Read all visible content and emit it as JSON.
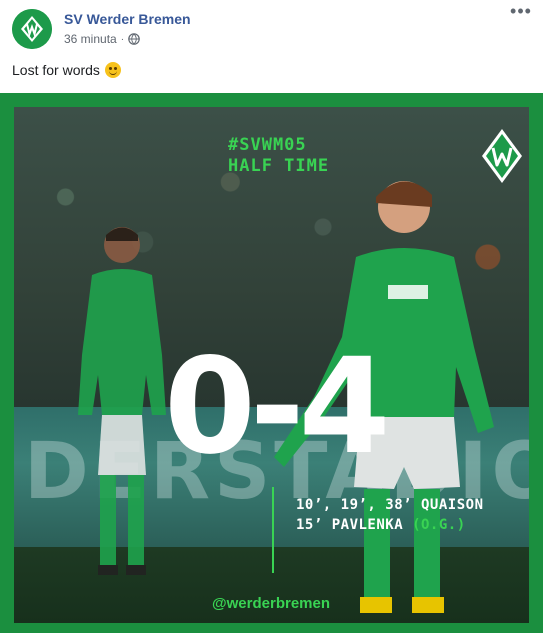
{
  "post": {
    "page_name": "SV Werder Bremen",
    "timestamp": "36 minuta",
    "separator": "·",
    "privacy_icon": "globe-icon",
    "more_icon": "more-options-icon",
    "text": "Lost for words",
    "emoji": "upside-down-face-emoji"
  },
  "graphic": {
    "hashtag": "#SVWM05",
    "status": "HALF TIME",
    "score": "0-4",
    "scorers_line1": "10’, 19’, 38’ QUAISON",
    "scorers_line2_name": "15’ PAVLENKA ",
    "scorers_line2_og": "(O.G.)",
    "handle": "@werderbremen",
    "board_text": "DERSTADION",
    "colors": {
      "brand_green": "#1b8f3f",
      "accent_green": "#39d353",
      "link_blue": "#385898"
    }
  }
}
